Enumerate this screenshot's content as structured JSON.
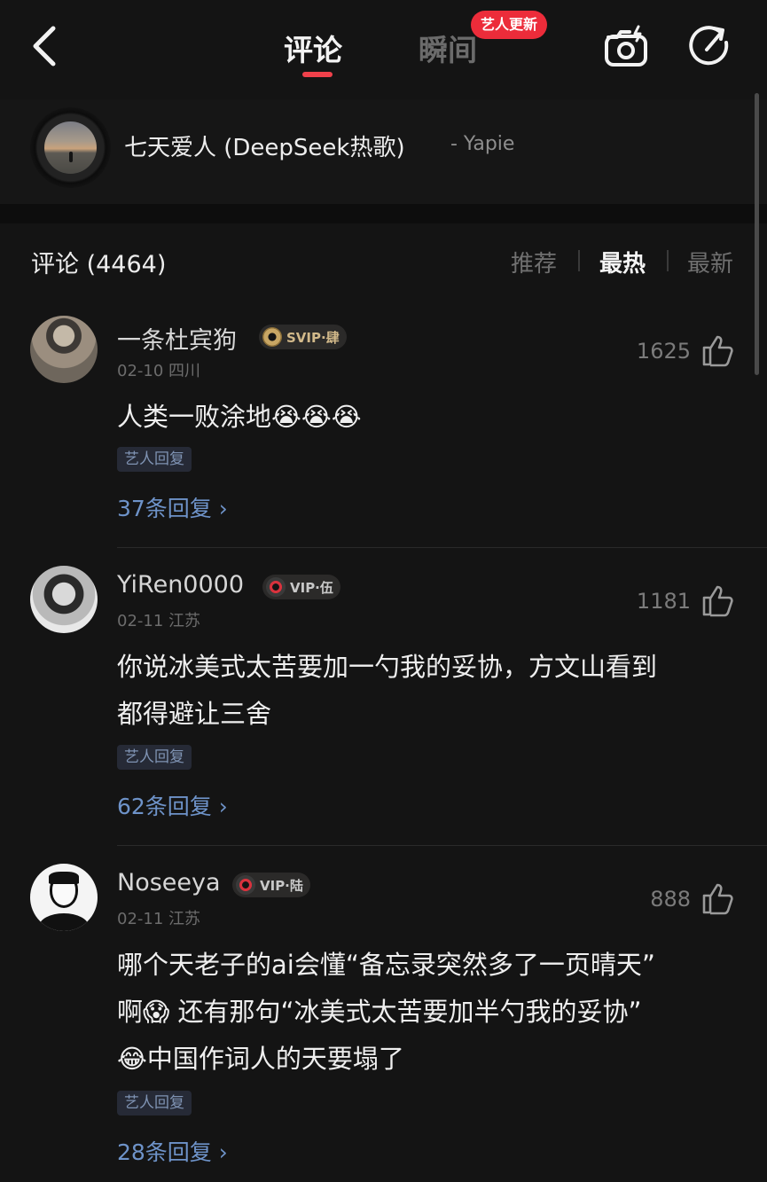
{
  "topbar": {
    "tabs": [
      {
        "label": "评论"
      },
      {
        "label": "瞬间"
      }
    ],
    "badge": "艺人更新",
    "icons": [
      "back-chevron-icon",
      "camera-icon",
      "share-icon"
    ],
    "accent_color": "#f0414b"
  },
  "song": {
    "title": "七天爱人 (DeepSeek热歌)",
    "artist": "- Yapie"
  },
  "comments_header": {
    "title": "评论 (4464)",
    "sort": [
      "推荐",
      "最热",
      "最新"
    ],
    "active_sort": "最热"
  },
  "comments": [
    {
      "user": "一条杜宾狗",
      "vip": "SVIP·肆",
      "meta": "02-10 四川",
      "likes": "1625",
      "text_lines": [
        "人类一败涂地😭😭😭"
      ],
      "artist_reply_tag": "艺人回复",
      "replies": "37条回复 ›"
    },
    {
      "user": "YiRen0000",
      "vip": "VIP·伍",
      "meta": "02-11 江苏",
      "likes": "1181",
      "text_lines": [
        "你说冰美式太苦要加一勺我的妥协，方文山看到",
        "都得避让三舍"
      ],
      "artist_reply_tag": "艺人回复",
      "replies": "62条回复 ›"
    },
    {
      "user": "Noseeya",
      "vip": "VIP·陆",
      "meta": "02-11 江苏",
      "likes": "888",
      "text_lines": [
        "哪个天老子的ai会懂“备忘录突然多了一页晴天”",
        "啊😱 还有那句“冰美式太苦要加半勺我的妥协”",
        "😂中国作词人的天要塌了"
      ],
      "artist_reply_tag": "艺人回复",
      "replies": "28条回复 ›"
    }
  ]
}
